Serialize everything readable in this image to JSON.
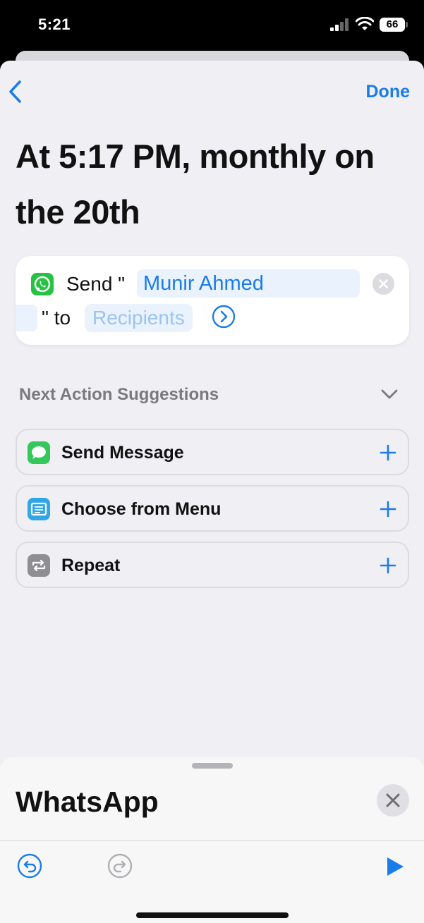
{
  "status_bar": {
    "time": "5:21",
    "battery": "66"
  },
  "nav": {
    "done_label": "Done"
  },
  "title": "At 5:17 PM, monthly on the 20th",
  "action": {
    "send_prefix": "Send \"",
    "name_value": "Munir Ahmed",
    "to_text": "\" to",
    "recipients_placeholder": "Recipients"
  },
  "suggestions": {
    "header": "Next Action Suggestions",
    "items": [
      {
        "label": "Send Message",
        "icon": "messages-icon",
        "color": "#34c759"
      },
      {
        "label": "Choose from Menu",
        "icon": "menu-icon",
        "color": "#30a6e6"
      },
      {
        "label": "Repeat",
        "icon": "repeat-icon",
        "color": "#8e8e93"
      }
    ]
  },
  "bottom": {
    "app_title": "WhatsApp"
  },
  "colors": {
    "accent": "#1a7ce8",
    "whatsapp": "#26c243"
  }
}
